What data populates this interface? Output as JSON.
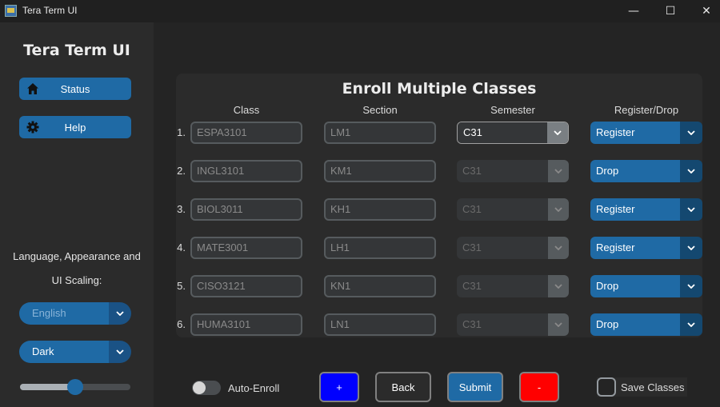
{
  "window": {
    "title": "Tera Term UI",
    "minimize_glyph": "—",
    "maximize_glyph": "☐",
    "close_glyph": "✕"
  },
  "sidebar": {
    "app_title": "Tera Term UI",
    "status_label": "Status",
    "help_label": "Help",
    "lang_label_line1": "Language, Appearance and",
    "lang_label_line2": "UI Scaling:",
    "language_value": "English",
    "appearance_value": "Dark",
    "scaling_fraction": 0.5
  },
  "panel": {
    "title": "Enroll Multiple Classes",
    "headers": {
      "class": "Class",
      "section": "Section",
      "semester": "Semester",
      "register_drop": "Register/Drop"
    },
    "rows": [
      {
        "num": "1.",
        "class": "ESPA3101",
        "section": "LM1",
        "semester": "C31",
        "action": "Register"
      },
      {
        "num": "2.",
        "class": "INGL3101",
        "section": "KM1",
        "semester": "C31",
        "action": "Drop"
      },
      {
        "num": "3.",
        "class": "BIOL3011",
        "section": "KH1",
        "semester": "C31",
        "action": "Register"
      },
      {
        "num": "4.",
        "class": "MATE3001",
        "section": "LH1",
        "semester": "C31",
        "action": "Register"
      },
      {
        "num": "5.",
        "class": "CISO3121",
        "section": "KN1",
        "semester": "C31",
        "action": "Drop"
      },
      {
        "num": "6.",
        "class": "HUMA3101",
        "section": "LN1",
        "semester": "C31",
        "action": "Drop"
      }
    ]
  },
  "footer": {
    "auto_enroll_label": "Auto-Enroll",
    "auto_enroll_on": false,
    "add_label": "+",
    "back_label": "Back",
    "submit_label": "Submit",
    "remove_label": "-",
    "save_classes_label": "Save Classes",
    "save_classes_checked": false
  },
  "colors": {
    "accent": "#1f6aa5",
    "accent_dark": "#144870",
    "add_button": "#0000ff",
    "remove_button": "#ff0000",
    "background": "#242424",
    "panel": "#2b2b2b"
  },
  "icons": {
    "status": "home-icon",
    "help": "gear-icon",
    "dropdown": "chevron-down-icon"
  }
}
